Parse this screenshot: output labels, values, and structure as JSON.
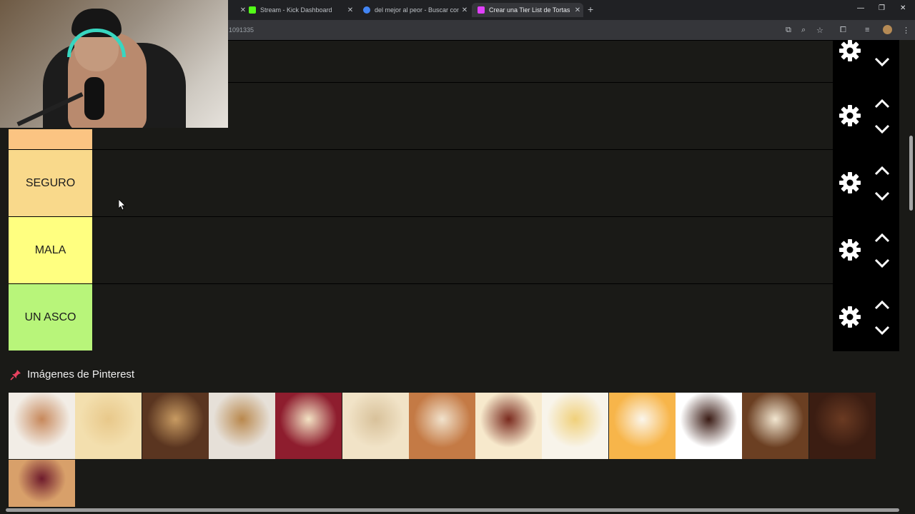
{
  "browser": {
    "tabs": [
      {
        "label": "Stream - Kick Dashboard",
        "favicon_color": "#53fc18"
      },
      {
        "label": "del mejor al peor - Buscar con G",
        "favicon_color": "#4285f4"
      },
      {
        "label": "Crear una Tier List de Tortas bie",
        "favicon_color": "#e040fb"
      }
    ],
    "url": "1091335",
    "new_tab_label": "+",
    "close_label": "✕",
    "window_controls": [
      "—",
      "❐",
      "✕"
    ]
  },
  "tiers": [
    {
      "label": "",
      "color": "#fbc482"
    },
    {
      "label": "SEGURO",
      "color": "#f9d98b"
    },
    {
      "label": "MALA",
      "color": "#ffff80"
    },
    {
      "label": "UN ASCO",
      "color": "#b8f57a"
    }
  ],
  "controls": {
    "icons": [
      "gear-icon",
      "chevron-up-icon",
      "chevron-down-icon"
    ]
  },
  "pinterest": {
    "title": "Imágenes de Pinterest",
    "icon": "pin-icon",
    "images": [
      {
        "name": "merengue-crepe-cake",
        "colors": [
          "#f2ede6",
          "#c7885b"
        ]
      },
      {
        "name": "vanilla-layer-cake",
        "colors": [
          "#f3dfae",
          "#e8c88a"
        ]
      },
      {
        "name": "chocolate-layer-cake",
        "colors": [
          "#5a3520",
          "#c89b62"
        ]
      },
      {
        "name": "lattice-caramel-cake",
        "colors": [
          "#e6e0d8",
          "#b9884d"
        ]
      },
      {
        "name": "berry-cheesecake",
        "colors": [
          "#8e1d2e",
          "#f3e3c4"
        ]
      },
      {
        "name": "powdered-sponge-cake",
        "colors": [
          "#f1e3c7",
          "#d8c19a"
        ]
      },
      {
        "name": "gateau-decorated-cake",
        "colors": [
          "#c47a45",
          "#f1e2cc"
        ]
      },
      {
        "name": "mousse-slice",
        "colors": [
          "#f7e9cc",
          "#7a2b1f"
        ]
      },
      {
        "name": "lemon-meringue-pie",
        "colors": [
          "#f8f4ea",
          "#f0d07a"
        ]
      },
      {
        "name": "peach-cream-cake",
        "colors": [
          "#f7b54a",
          "#fbf6ec"
        ]
      },
      {
        "name": "black-forest-cake",
        "colors": [
          "#ffffff",
          "#3a1b14"
        ]
      },
      {
        "name": "tiramisu",
        "colors": [
          "#6b3f22",
          "#f2e6d0"
        ]
      },
      {
        "name": "chocolate-fudge-slice",
        "colors": [
          "#3b1d12",
          "#6a3a22"
        ]
      },
      {
        "name": "cherry-lattice-pie",
        "colors": [
          "#d8a06a",
          "#6e1b2c"
        ]
      }
    ]
  }
}
